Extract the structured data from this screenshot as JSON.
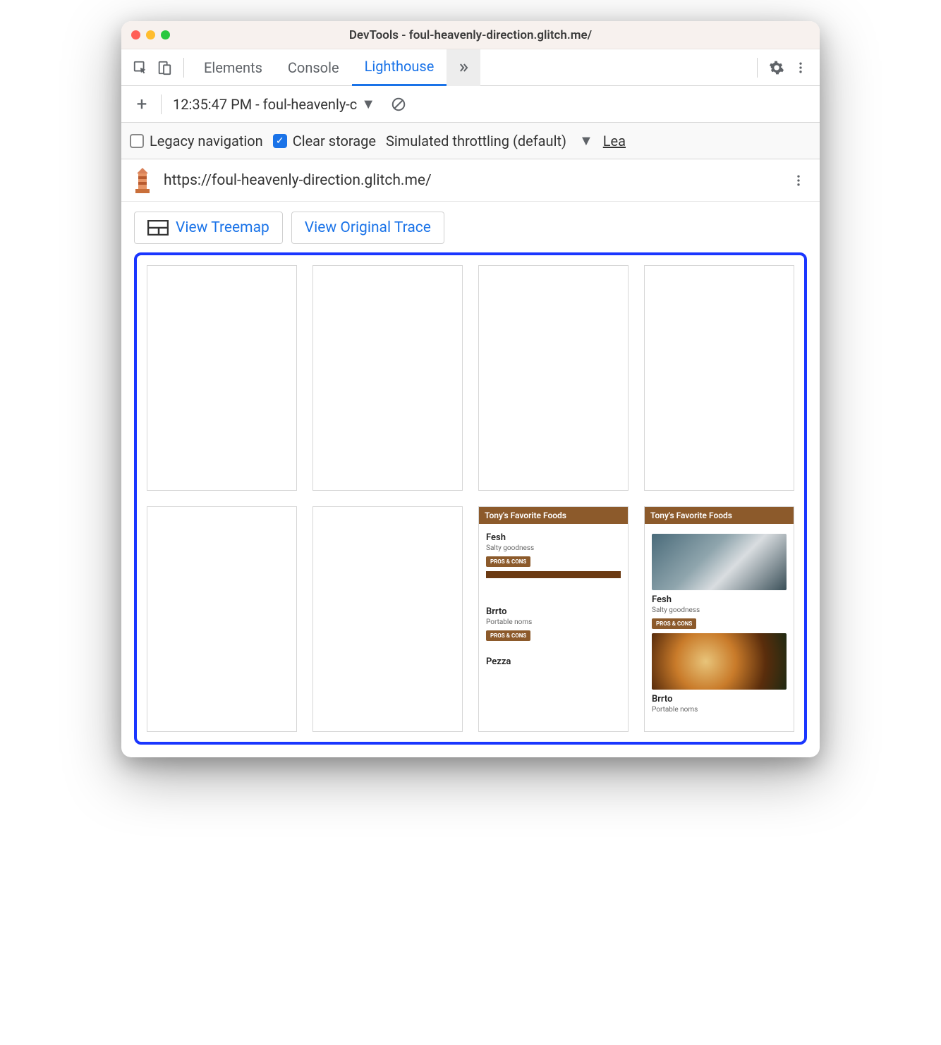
{
  "window": {
    "title": "DevTools - foul-heavenly-direction.glitch.me/"
  },
  "tabs": {
    "elements": "Elements",
    "console": "Console",
    "lighthouse": "Lighthouse"
  },
  "report_selector": "12:35:47 PM - foul-heavenly-c",
  "options": {
    "legacy_label": "Legacy navigation",
    "clear_label": "Clear storage",
    "throttle_label": "Simulated throttling (default)",
    "learn_label": "Lea"
  },
  "url": "https://foul-heavenly-direction.glitch.me/",
  "buttons": {
    "treemap": "View Treemap",
    "trace": "View Original Trace"
  },
  "thumb": {
    "header": "Tony's Favorite Foods",
    "item1_title": "Fesh",
    "item1_sub": "Salty goodness",
    "item2_title": "Brrto",
    "item2_sub": "Portable noms",
    "item3_title": "Pezza",
    "badge": "PROS & CONS"
  }
}
